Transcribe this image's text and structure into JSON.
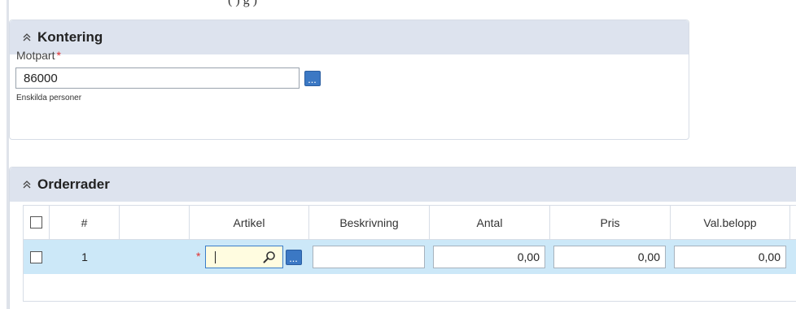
{
  "page_header": {
    "partial_text": "(                           )                                  g )"
  },
  "kontering": {
    "title": "Kontering",
    "motpart": {
      "label": "Motpart",
      "required_marker": "*",
      "value": "86000",
      "hint": "Enskilda personer",
      "lookup_button": "..."
    }
  },
  "orderrader": {
    "title": "Orderrader",
    "columns": [
      "",
      "#",
      "",
      "Artikel",
      "Beskrivning",
      "Antal",
      "Pris",
      "Val.belopp"
    ],
    "rows": [
      {
        "number": "1",
        "required_marker": "*",
        "artikel": "",
        "beskrivning": "",
        "antal": "0,00",
        "pris": "0,00",
        "val_belopp": "0,00",
        "artikel_lookup_button": "..."
      }
    ]
  },
  "colors": {
    "panel_header_bg": "#dde3ee",
    "selected_row_bg": "#cce8f8",
    "required": "#e03030",
    "lookup_button": "#3b78c4",
    "focus_input_bg": "#fffce0"
  },
  "icons": [
    "chevron-double-up-icon",
    "lookup-ellipsis-icon",
    "search-icon"
  ]
}
